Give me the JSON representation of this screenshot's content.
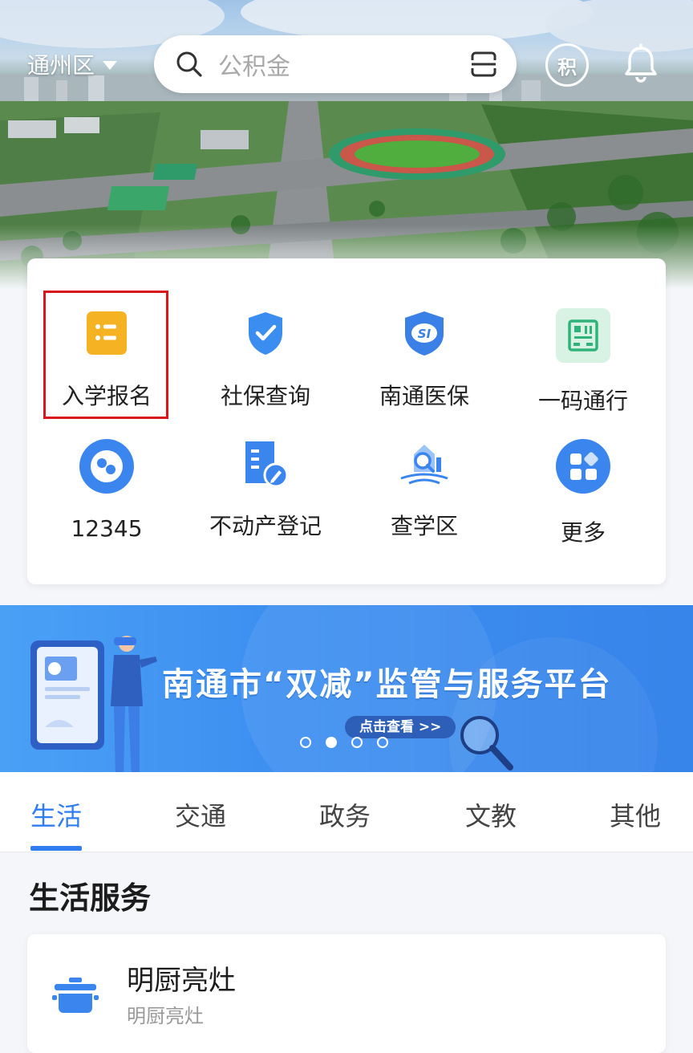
{
  "header": {
    "district": "通州区",
    "search_placeholder": "公积金",
    "points_label": "积"
  },
  "services": [
    {
      "label": "入学报名",
      "icon": "enrollment-list-icon"
    },
    {
      "label": "社保查询",
      "icon": "shield-check-icon"
    },
    {
      "label": "南通医保",
      "icon": "medical-insurance-si-icon"
    },
    {
      "label": "一码通行",
      "icon": "qr-code-pass-icon"
    },
    {
      "label": "12345",
      "icon": "hotline-12345-icon"
    },
    {
      "label": "不动产登记",
      "icon": "property-registration-icon"
    },
    {
      "label": "查学区",
      "icon": "school-district-icon"
    },
    {
      "label": "更多",
      "icon": "more-apps-icon"
    }
  ],
  "banner": {
    "title": "南通市“双减”监管与服务平台",
    "cta": "点击查看 >>",
    "active_dot_index": 1,
    "dot_count": 4
  },
  "tabs": [
    "生活",
    "交通",
    "政务",
    "文教",
    "其他"
  ],
  "active_tab": "生活",
  "life_section": {
    "title": "生活服务",
    "item_title": "明厨亮灶",
    "item_subtitle": "明厨亮灶"
  },
  "colors": {
    "accent": "#2f7df0",
    "enroll_orange": "#f5b323",
    "highlight_red": "#d8141c",
    "banner_blue": "#3d8ff0"
  }
}
